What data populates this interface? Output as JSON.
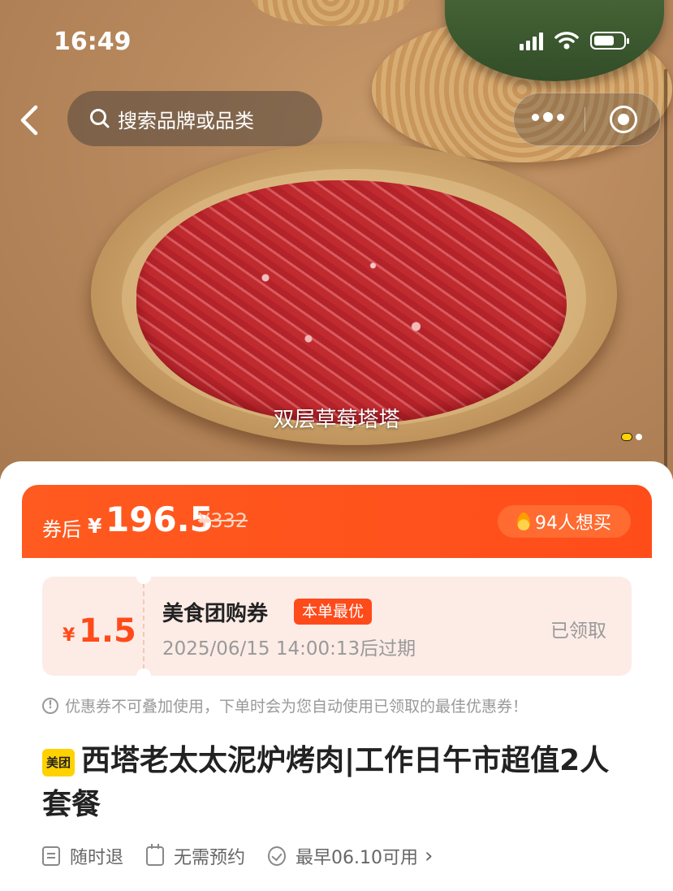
{
  "status_bar": {
    "time": "16:49"
  },
  "nav": {
    "search_placeholder": "搜索品牌或品类"
  },
  "hero": {
    "caption": "双层草莓塔塔"
  },
  "price": {
    "after_coupon_label": "券后",
    "currency": "¥",
    "value": "196.5",
    "original": "¥332",
    "want_count": "94人想买"
  },
  "coupon": {
    "currency": "¥",
    "amount": "1.5",
    "title": "美食团购券",
    "badge": "本单最优",
    "expiry": "2025/06/15 14:00:13后过期",
    "status": "已领取"
  },
  "notice": "优惠券不可叠加使用，下单时会为您自动使用已领取的最佳优惠券！",
  "deal": {
    "brand_badge": "美团",
    "title": "西塔老太太泥炉烤肉|工作日午市超值2人套餐"
  },
  "tags": [
    {
      "label": "随时退"
    },
    {
      "label": "无需预约"
    },
    {
      "label": "最早06.10可用"
    }
  ],
  "colors": {
    "accent": "#ff4a1a",
    "brand_yellow": "#ffd100"
  }
}
